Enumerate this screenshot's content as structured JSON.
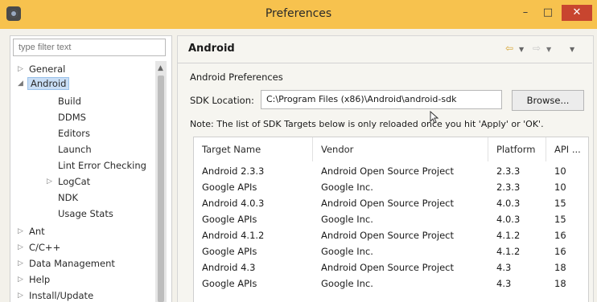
{
  "window": {
    "title": "Preferences"
  },
  "window_controls": {
    "minimize": "–",
    "maximize": "□",
    "close": "✕"
  },
  "filter": {
    "placeholder": "type filter text"
  },
  "tree": {
    "general": "General",
    "android": "Android",
    "android_children": [
      "Build",
      "DDMS",
      "Editors",
      "Launch",
      "Lint Error Checking",
      "LogCat",
      "NDK",
      "Usage Stats"
    ],
    "after": [
      "Ant",
      "C/C++",
      "Data Management",
      "Help",
      "Install/Update"
    ]
  },
  "panel": {
    "title": "Android",
    "section": "Android Preferences",
    "sdk_label": "SDK Location:",
    "sdk_value": "C:\\Program Files (x86)\\Android\\android-sdk",
    "browse": "Browse...",
    "note": "Note: The list of SDK Targets below is only reloaded once you hit 'Apply' or 'OK'."
  },
  "nav_icons": {
    "back": "back-arrow-icon",
    "forward": "forward-arrow-icon",
    "menu": "view-menu-icon"
  },
  "table": {
    "headers": [
      "Target Name",
      "Vendor",
      "Platform",
      "API ..."
    ],
    "rows": [
      [
        "Android 2.3.3",
        "Android Open Source Project",
        "2.3.3",
        "10"
      ],
      [
        "Google APIs",
        "Google Inc.",
        "2.3.3",
        "10"
      ],
      [
        "Android 4.0.3",
        "Android Open Source Project",
        "4.0.3",
        "15"
      ],
      [
        "Google APIs",
        "Google Inc.",
        "4.0.3",
        "15"
      ],
      [
        "Android 4.1.2",
        "Android Open Source Project",
        "4.1.2",
        "16"
      ],
      [
        "Google APIs",
        "Google Inc.",
        "4.1.2",
        "16"
      ],
      [
        "Android 4.3",
        "Android Open Source Project",
        "4.3",
        "18"
      ],
      [
        "Google APIs",
        "Google Inc.",
        "4.3",
        "18"
      ]
    ]
  },
  "colors": {
    "titlebar": "#f7c24e",
    "close": "#c8452f",
    "selection": "#c9def5"
  }
}
